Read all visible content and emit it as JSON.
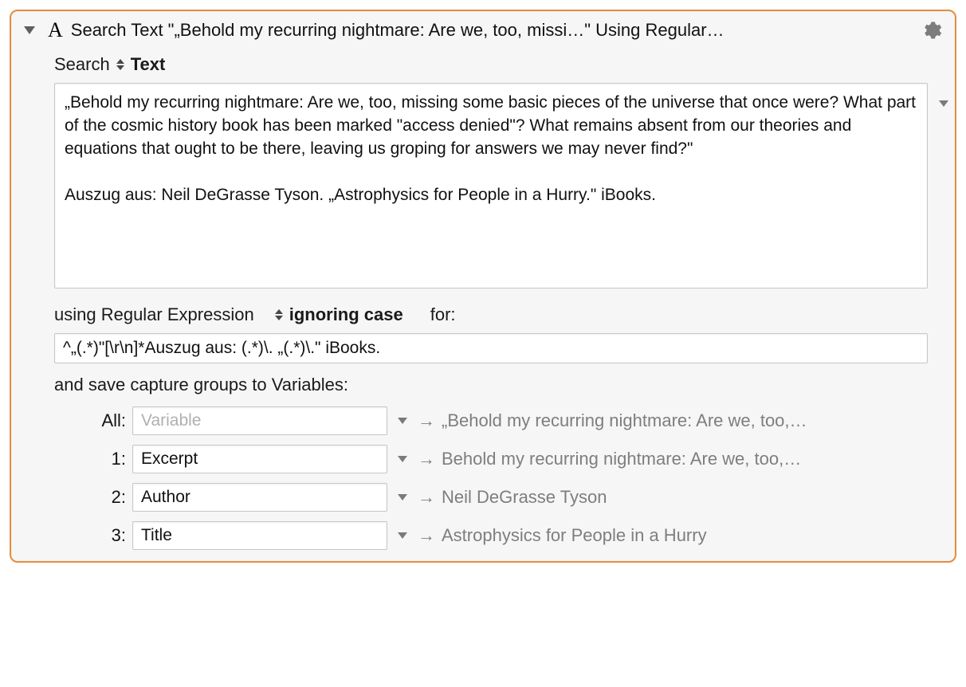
{
  "header": {
    "title": "Search Text \"„Behold my recurring nightmare: Are we, too, missi…\" Using Regular…"
  },
  "search": {
    "prefix": "Search",
    "mode": "Text",
    "value": "„Behold my recurring nightmare: Are we, too, missing some basic pieces of the universe that once were? What part of the cosmic history book has been marked \"access denied\"? What remains absent from our theories and equations that ought to be there, leaving us groping for answers we may never find?\"\n\nAuszug aus: Neil DeGrasse Tyson. „Astrophysics for People in a Hurry.\" iBooks."
  },
  "regex": {
    "using_label": "using Regular Expression",
    "case_label": "ignoring case",
    "for_label": "for:",
    "pattern": "^„(.*)\"[\\r\\n]*Auszug aus: (.*)\\. „(.*)\\.\" iBooks."
  },
  "save_label": "and save capture groups to Variables:",
  "arrow": "→",
  "placeholder_variable": "Variable",
  "groups": [
    {
      "label": "All:",
      "name": "",
      "preview": "„Behold my recurring nightmare: Are we, too,…"
    },
    {
      "label": "1:",
      "name": "Excerpt",
      "preview": "Behold my recurring nightmare: Are we, too,…"
    },
    {
      "label": "2:",
      "name": "Author",
      "preview": "Neil DeGrasse Tyson"
    },
    {
      "label": "3:",
      "name": "Title",
      "preview": "Astrophysics for People in a Hurry"
    }
  ]
}
